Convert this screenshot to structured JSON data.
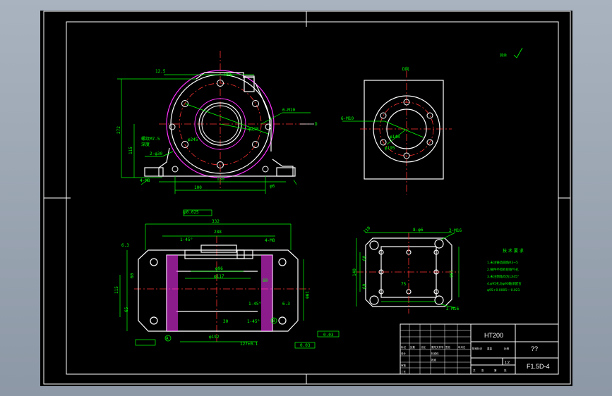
{
  "drawing": {
    "material": "HT200",
    "part_name": "??",
    "drawing_number": "F1.5D-4",
    "roughness_note": "其余"
  },
  "title_block": {
    "scale": "1:2",
    "small_labels": [
      "标记",
      "处数",
      "分区",
      "更改文件号",
      "签名",
      "年月日",
      "设计",
      "审核",
      "工艺",
      "标准化",
      "批准",
      "阶段标记",
      "重量",
      "比例",
      "共",
      "张",
      "第",
      "张"
    ]
  },
  "tech_requirements": {
    "title": "技 术 要 求",
    "lines": [
      "1.未注铸造圆角R3~5",
      "2.铸件不得有砂眼气孔",
      "3.未注倒角均为1X45°",
      "4.φ95孔与φ90轴承配合",
      "φ95+0.0005~-0.021"
    ]
  },
  "front_view": {
    "dims": [
      "12.5",
      "272",
      "115",
      "100",
      "150",
      "4-M8",
      "2-φ30",
      "6-M10",
      "φ218",
      "φ245",
      "R95",
      "φ6",
      "螺纹M7.5",
      "深度",
      "D"
    ]
  },
  "side_view": {
    "dims": [
      "D向",
      "6-M10",
      "φ148",
      "φ195"
    ]
  },
  "top_view": {
    "dims": [
      "332",
      "288",
      "φ0.025",
      "6.3",
      "1-45°",
      "φ96",
      "φ117",
      "4-M8",
      "60",
      "60",
      "65",
      "115",
      "100",
      "30",
      "φ192",
      "127±0.1",
      "0.03",
      "0.03",
      "1-45°",
      "A",
      "B",
      "6.3",
      "1-45°"
    ]
  },
  "bottom_view": {
    "dims": [
      "110",
      "8-φ6",
      "2-M16",
      "140",
      "60",
      "100",
      "75",
      "60",
      "2-M16"
    ]
  }
}
